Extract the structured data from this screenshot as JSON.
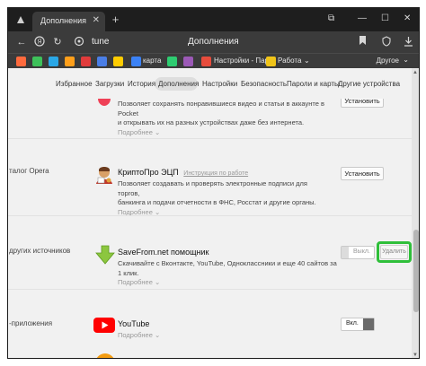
{
  "titlebar": {
    "tab_label": "Дополнения",
    "tab_close": "✕",
    "new_tab": "+",
    "controls": {
      "bookmarks": "⧉",
      "minimize": "—",
      "maximize": "☐",
      "close": "✕"
    }
  },
  "addressbar": {
    "address_text": "tune",
    "page_title": "Дополнения"
  },
  "bookmarks": {
    "items": [
      {
        "label": "",
        "color": "#ff6a3d"
      },
      {
        "label": "",
        "color": "#3ec15a"
      },
      {
        "label": "",
        "color": "#2aa7e6"
      },
      {
        "label": "",
        "color": "#ff9f1a"
      },
      {
        "label": "",
        "color": "#e03b3b"
      },
      {
        "label": "",
        "color": "#4a7ee6"
      },
      {
        "label": "",
        "color": "#ffcc00"
      },
      {
        "label": "",
        "color": "#3b82f6"
      },
      {
        "label": "",
        "color": "#2ecc71"
      },
      {
        "label": "",
        "color": "#9b59b6"
      },
      {
        "label": "",
        "color": "#e74c3c"
      },
      {
        "label": "",
        "color": "#5dade2"
      }
    ],
    "map_label": "карта",
    "settings_label": "Настройки - Пар",
    "work_label": "Работа",
    "other_label": "Другое"
  },
  "settings_nav": {
    "tabs": [
      "Избранное",
      "Загрузки",
      "История",
      "Дополнения",
      "Настройки",
      "Безопасность",
      "Пароли и карты",
      "Другие устройства"
    ]
  },
  "content": {
    "left_labels": {
      "catalog": "талог Opera",
      "other_sources": "другиx источников",
      "apps": "-приложения"
    },
    "extensions": [
      {
        "name": "",
        "desc_line1": "Позволяет сохранять понравившиеся видео и статьи в аккаунте в Pocket",
        "desc_line2": "и открывать их на разных устройствах даже без интернета.",
        "more": "Подробнее",
        "button": "Установить"
      },
      {
        "name": "КриптоПро ЭЦП",
        "link": "Инструкция по работе",
        "desc_line1": "Позволяет создавать и проверять электронные подписи для торгов,",
        "desc_line2": "банкинга и подачи отчетности в ФНС, Росстат и другие органы.",
        "more": "Подробнее",
        "button": "Установить"
      },
      {
        "name": "SaveFrom.net помощник",
        "desc_line1": "Скачивайте с Вконтакте, YouTube, Одноклассники и еще 40 сайтов за 1 клик.",
        "more": "Подробнее",
        "toggle_label": "Выкл.",
        "delete_label": "Удалить"
      },
      {
        "name": "YouTube",
        "more": "Подробнее",
        "toggle_label": "Вкл."
      }
    ]
  },
  "icons": {
    "pocket": "pocket-icon",
    "cryptopro": "cryptopro-icon",
    "savefrom": "savefrom-download-icon",
    "youtube": "youtube-icon"
  }
}
